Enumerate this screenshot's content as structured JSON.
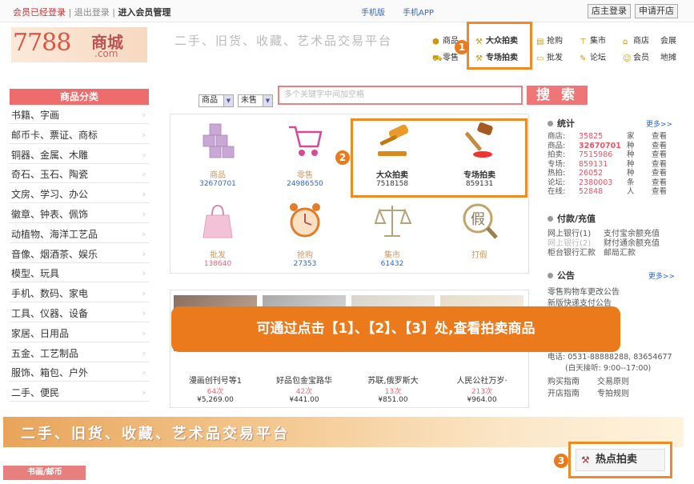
{
  "topbar": {
    "logged_in": "会员已经登录",
    "logout": "退出登录",
    "sep": "|",
    "member_admin": "进入会员管理",
    "mobile_ver": "手机版",
    "mobile_app": "手机APP",
    "store_login": "店主登录",
    "apply_store": "申请开店"
  },
  "logo": {
    "num": "7788",
    "cn": "商城",
    "com": ".com"
  },
  "slogan": "二手、旧货、收藏、艺术品交易平台",
  "nav": {
    "row1": [
      "商品",
      "大众拍卖",
      "抢购",
      "集市",
      "商店",
      "会展"
    ],
    "row2": [
      "零售",
      "专场拍卖",
      "批发",
      "论坛",
      "会员",
      "地摊"
    ]
  },
  "badges": [
    "1",
    "2",
    "3"
  ],
  "sidebar": {
    "title": "商品分类",
    "items": [
      "书籍、字画",
      "邮币卡、票证、商标",
      "铜器、金属、木雕",
      "奇石、玉石、陶瓷",
      "文房、学习、办公",
      "徽章、钟表、佩饰",
      "动植物、海洋工艺品",
      "音像、烟酒茶、娱乐",
      "模型、玩具",
      "手机、数码、家电",
      "工具、仪器、设备",
      "家居、日用品",
      "五金、工艺制品",
      "服饰、箱包、户外",
      "二手、便民"
    ],
    "chevron": "›"
  },
  "search": {
    "select1": "商品",
    "select2": "未售",
    "placeholder": "多个关键字中间加空格",
    "button": "搜 索"
  },
  "grid": [
    {
      "label": "商品",
      "num": "32670701"
    },
    {
      "label": "零售",
      "num": "24986550"
    },
    {
      "label": "大众拍卖",
      "num": "7518158"
    },
    {
      "label": "专场拍卖",
      "num": "859131"
    },
    {
      "label": "批发",
      "num": "138640"
    },
    {
      "label": "抢购",
      "num": "27353"
    },
    {
      "label": "集市",
      "num": "61432"
    },
    {
      "label": "打假",
      "num": ""
    }
  ],
  "products": [
    {
      "title": "漫画创刊号等1",
      "count": "64次",
      "price": "¥5,269.00"
    },
    {
      "title": "好品包金宝路华",
      "count": "42次",
      "price": "¥441.00"
    },
    {
      "title": "苏联,俄罗斯大",
      "count": "13次",
      "price": "¥851.00"
    },
    {
      "title": "人民公社万岁·",
      "count": "213次",
      "price": "¥964.00"
    }
  ],
  "stats": {
    "title": "统计",
    "more": "更多>>",
    "view": "查看",
    "rows": [
      {
        "k": "商店:",
        "v": "35825",
        "u": "家"
      },
      {
        "k": "商品:",
        "v": "32670701",
        "u": "种"
      },
      {
        "k": "拍卖:",
        "v": "7515986",
        "u": "种"
      },
      {
        "k": "专场:",
        "v": "859131",
        "u": "种"
      },
      {
        "k": "热拍:",
        "v": "26052",
        "u": "种"
      },
      {
        "k": "论坛:",
        "v": "2380003",
        "u": "条"
      },
      {
        "k": "在线:",
        "v": "52848",
        "u": "人"
      }
    ]
  },
  "payment": {
    "title": "付款/充值",
    "rows": [
      {
        "a": "网上银行(1)",
        "b": "支付宝余额充值"
      },
      {
        "a": "网上银行(2)",
        "b": "财付通余额充值"
      },
      {
        "a": "柜台银行汇款",
        "b": "邮局汇款"
      }
    ]
  },
  "notice": {
    "title": "公告",
    "more": "更多>>",
    "items": [
      "零售购物车更改公告",
      "新版快递支付公告"
    ]
  },
  "contact": {
    "phone": "电话: 0531-88888288, 83654677",
    "hours": "(白天接听: 9:00--17:00)"
  },
  "guides": [
    {
      "a": "购买指南",
      "b": "交易原则"
    },
    {
      "a": "开店指南",
      "b": "专拍规则"
    }
  ],
  "callout": "可通过点击【1】、【2】、【3】处,查看拍卖商品",
  "banner": "二手、旧货、收藏、艺术品交易平台",
  "hot_auction": "热点拍卖",
  "section_tab": "书画/邮币",
  "colors": {
    "accent": "#ea7a1c",
    "red": "#ef6c6c",
    "link": "#3366cc"
  }
}
